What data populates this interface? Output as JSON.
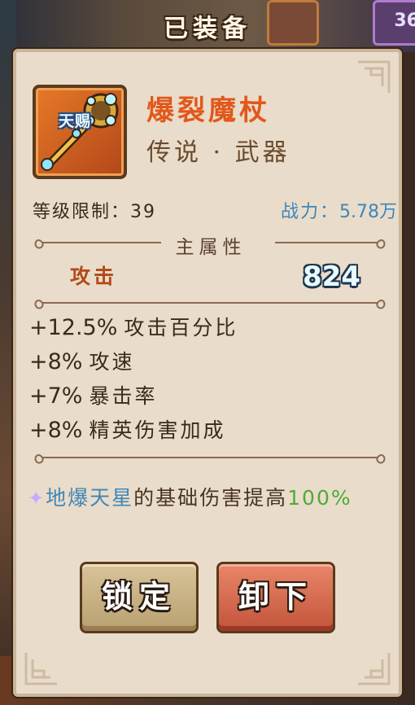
{
  "header": {
    "title": "已装备"
  },
  "background": {
    "tile_count": "36"
  },
  "item": {
    "badge": "天赐",
    "name": "爆裂魔杖",
    "type": "传说 · 武器",
    "icon": "magic-staff-icon"
  },
  "level": {
    "label": "等级限制：",
    "value": "39"
  },
  "power": {
    "label": "战力：",
    "value": "5.78万"
  },
  "main_attribute": {
    "section_title": "主属性",
    "stat_name": "攻击",
    "stat_value": "824"
  },
  "sub_stats": [
    {
      "value": "+12.5%",
      "name": "攻击百分比"
    },
    {
      "value": "+8%",
      "name": "攻速"
    },
    {
      "value": "+7%",
      "name": "暴击率"
    },
    {
      "value": "+8%",
      "name": "精英伤害加成"
    }
  ],
  "skill": {
    "icon": "sparkle-icon",
    "name": "地爆天星",
    "text": "的基础伤害提高",
    "value": "100%"
  },
  "buttons": {
    "lock": "锁定",
    "unequip": "卸下"
  },
  "colors": {
    "panel_bg": "#e9dcca",
    "name_orange": "#e2571a",
    "power_blue": "#3f86b8",
    "skill_green": "#4faa3a",
    "lock_button": "#c9b384",
    "unequip_button": "#d96a4e"
  }
}
